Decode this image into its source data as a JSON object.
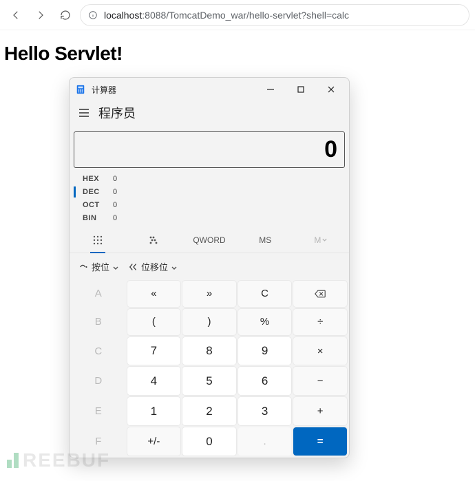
{
  "browser": {
    "url_host": "localhost",
    "url_port": ":8088",
    "url_path": "/TomcatDemo_war/hello-servlet?shell=calc"
  },
  "page": {
    "heading": "Hello Servlet!"
  },
  "calc": {
    "app_title": "计算器",
    "mode": "程序员",
    "display": "0",
    "radix": [
      {
        "label": "HEX",
        "value": "0",
        "selected": false
      },
      {
        "label": "DEC",
        "value": "0",
        "selected": true
      },
      {
        "label": "OCT",
        "value": "0",
        "selected": false
      },
      {
        "label": "BIN",
        "value": "0",
        "selected": false
      }
    ],
    "tools": {
      "qword": "QWORD",
      "ms": "MS",
      "mdrop": "M"
    },
    "bits": {
      "bitwise": "按位",
      "bitshift": "位移位"
    },
    "keys": {
      "A": "A",
      "ls": "«",
      "rs": "»",
      "C": "C",
      "B": "B",
      "lp": "(",
      "rp": ")",
      "pct": "%",
      "div": "÷",
      "Cc": "C",
      "n7": "7",
      "n8": "8",
      "n9": "9",
      "mul": "×",
      "D": "D",
      "n4": "4",
      "n5": "5",
      "n6": "6",
      "sub": "−",
      "E": "E",
      "n1": "1",
      "n2": "2",
      "n3": "3",
      "add": "+",
      "F": "F",
      "pm": "+/-",
      "n0": "0",
      "dot": ".",
      "eq": "="
    }
  },
  "watermark": "REEBUF"
}
